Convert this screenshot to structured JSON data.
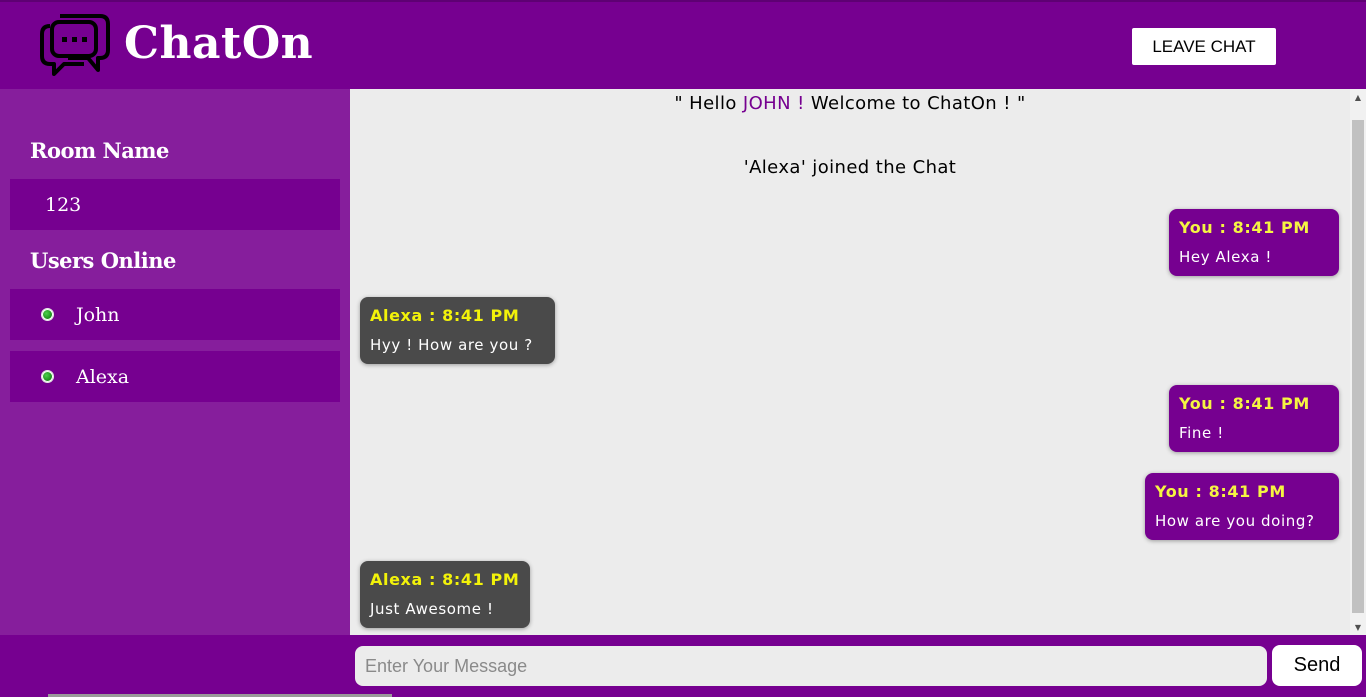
{
  "header": {
    "app_title": "ChatOn",
    "logo_icon": "chat-bubbles-icon",
    "leave_label": "LEAVE CHAT"
  },
  "sidebar": {
    "room_heading": "Room Name",
    "room_value": "123",
    "users_heading": "Users Online",
    "users": [
      {
        "name": "John",
        "status": "online"
      },
      {
        "name": "Alexa",
        "status": "online"
      }
    ]
  },
  "chat": {
    "welcome": {
      "prefix": "\" Hello ",
      "name": "JOHN !",
      "suffix": " Welcome to ChatOn ! \""
    },
    "joined_notice": "'Alexa' joined the Chat",
    "messages": [
      {
        "side": "mine",
        "meta": "You : 8:41 PM",
        "text": "Hey Alexa !"
      },
      {
        "side": "theirs",
        "meta": "Alexa : 8:41 PM",
        "text": "Hyy ! How are you ?"
      },
      {
        "side": "mine",
        "meta": "You : 8:41 PM",
        "text": "Fine !"
      },
      {
        "side": "mine",
        "meta": "You : 8:41 PM",
        "text": "How are you doing?"
      },
      {
        "side": "theirs",
        "meta": "Alexa : 8:41 PM",
        "text": "Just Awesome !"
      }
    ]
  },
  "composer": {
    "placeholder": "Enter Your Message",
    "value": "",
    "send_label": "Send"
  },
  "colors": {
    "brand_purple": "#760090",
    "sidebar_purple": "#861e9c",
    "bubble_mine": "#760090",
    "bubble_theirs": "#4a4a4a",
    "meta_yellow": "#f5f542",
    "online_green": "#1a8a1a"
  }
}
